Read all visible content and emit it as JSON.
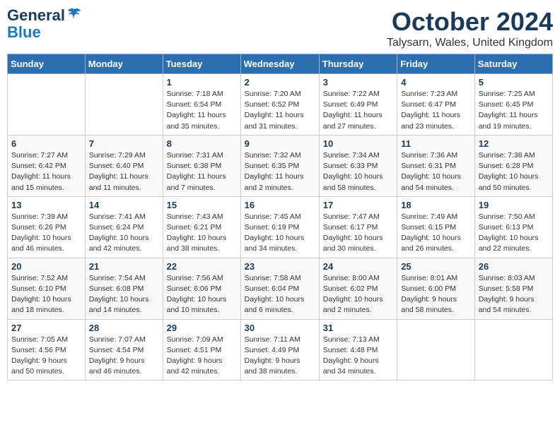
{
  "logo": {
    "line1": "General",
    "line2": "Blue"
  },
  "title": "October 2024",
  "subtitle": "Talysarn, Wales, United Kingdom",
  "days_of_week": [
    "Sunday",
    "Monday",
    "Tuesday",
    "Wednesday",
    "Thursday",
    "Friday",
    "Saturday"
  ],
  "weeks": [
    [
      {
        "day": "",
        "info": ""
      },
      {
        "day": "",
        "info": ""
      },
      {
        "day": "1",
        "info": "Sunrise: 7:18 AM\nSunset: 6:54 PM\nDaylight: 11 hours\nand 35 minutes."
      },
      {
        "day": "2",
        "info": "Sunrise: 7:20 AM\nSunset: 6:52 PM\nDaylight: 11 hours\nand 31 minutes."
      },
      {
        "day": "3",
        "info": "Sunrise: 7:22 AM\nSunset: 6:49 PM\nDaylight: 11 hours\nand 27 minutes."
      },
      {
        "day": "4",
        "info": "Sunrise: 7:23 AM\nSunset: 6:47 PM\nDaylight: 11 hours\nand 23 minutes."
      },
      {
        "day": "5",
        "info": "Sunrise: 7:25 AM\nSunset: 6:45 PM\nDaylight: 11 hours\nand 19 minutes."
      }
    ],
    [
      {
        "day": "6",
        "info": "Sunrise: 7:27 AM\nSunset: 6:42 PM\nDaylight: 11 hours\nand 15 minutes."
      },
      {
        "day": "7",
        "info": "Sunrise: 7:29 AM\nSunset: 6:40 PM\nDaylight: 11 hours\nand 11 minutes."
      },
      {
        "day": "8",
        "info": "Sunrise: 7:31 AM\nSunset: 6:38 PM\nDaylight: 11 hours\nand 7 minutes."
      },
      {
        "day": "9",
        "info": "Sunrise: 7:32 AM\nSunset: 6:35 PM\nDaylight: 11 hours\nand 2 minutes."
      },
      {
        "day": "10",
        "info": "Sunrise: 7:34 AM\nSunset: 6:33 PM\nDaylight: 10 hours\nand 58 minutes."
      },
      {
        "day": "11",
        "info": "Sunrise: 7:36 AM\nSunset: 6:31 PM\nDaylight: 10 hours\nand 54 minutes."
      },
      {
        "day": "12",
        "info": "Sunrise: 7:38 AM\nSunset: 6:28 PM\nDaylight: 10 hours\nand 50 minutes."
      }
    ],
    [
      {
        "day": "13",
        "info": "Sunrise: 7:39 AM\nSunset: 6:26 PM\nDaylight: 10 hours\nand 46 minutes."
      },
      {
        "day": "14",
        "info": "Sunrise: 7:41 AM\nSunset: 6:24 PM\nDaylight: 10 hours\nand 42 minutes."
      },
      {
        "day": "15",
        "info": "Sunrise: 7:43 AM\nSunset: 6:21 PM\nDaylight: 10 hours\nand 38 minutes."
      },
      {
        "day": "16",
        "info": "Sunrise: 7:45 AM\nSunset: 6:19 PM\nDaylight: 10 hours\nand 34 minutes."
      },
      {
        "day": "17",
        "info": "Sunrise: 7:47 AM\nSunset: 6:17 PM\nDaylight: 10 hours\nand 30 minutes."
      },
      {
        "day": "18",
        "info": "Sunrise: 7:49 AM\nSunset: 6:15 PM\nDaylight: 10 hours\nand 26 minutes."
      },
      {
        "day": "19",
        "info": "Sunrise: 7:50 AM\nSunset: 6:13 PM\nDaylight: 10 hours\nand 22 minutes."
      }
    ],
    [
      {
        "day": "20",
        "info": "Sunrise: 7:52 AM\nSunset: 6:10 PM\nDaylight: 10 hours\nand 18 minutes."
      },
      {
        "day": "21",
        "info": "Sunrise: 7:54 AM\nSunset: 6:08 PM\nDaylight: 10 hours\nand 14 minutes."
      },
      {
        "day": "22",
        "info": "Sunrise: 7:56 AM\nSunset: 6:06 PM\nDaylight: 10 hours\nand 10 minutes."
      },
      {
        "day": "23",
        "info": "Sunrise: 7:58 AM\nSunset: 6:04 PM\nDaylight: 10 hours\nand 6 minutes."
      },
      {
        "day": "24",
        "info": "Sunrise: 8:00 AM\nSunset: 6:02 PM\nDaylight: 10 hours\nand 2 minutes."
      },
      {
        "day": "25",
        "info": "Sunrise: 8:01 AM\nSunset: 6:00 PM\nDaylight: 9 hours\nand 58 minutes."
      },
      {
        "day": "26",
        "info": "Sunrise: 8:03 AM\nSunset: 5:58 PM\nDaylight: 9 hours\nand 54 minutes."
      }
    ],
    [
      {
        "day": "27",
        "info": "Sunrise: 7:05 AM\nSunset: 4:56 PM\nDaylight: 9 hours\nand 50 minutes."
      },
      {
        "day": "28",
        "info": "Sunrise: 7:07 AM\nSunset: 4:54 PM\nDaylight: 9 hours\nand 46 minutes."
      },
      {
        "day": "29",
        "info": "Sunrise: 7:09 AM\nSunset: 4:51 PM\nDaylight: 9 hours\nand 42 minutes."
      },
      {
        "day": "30",
        "info": "Sunrise: 7:11 AM\nSunset: 4:49 PM\nDaylight: 9 hours\nand 38 minutes."
      },
      {
        "day": "31",
        "info": "Sunrise: 7:13 AM\nSunset: 4:48 PM\nDaylight: 9 hours\nand 34 minutes."
      },
      {
        "day": "",
        "info": ""
      },
      {
        "day": "",
        "info": ""
      }
    ]
  ]
}
